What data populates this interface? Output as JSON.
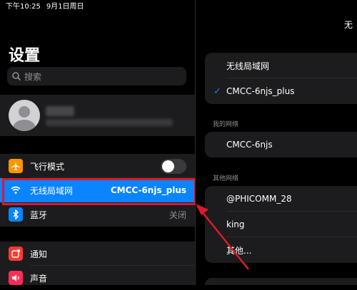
{
  "status_bar": {
    "time": "下午10:25",
    "date": "9月1日周日"
  },
  "sidebar": {
    "title": "设置",
    "search_placeholder": "搜索",
    "rows": [
      {
        "label": "飞行模式",
        "icon": "airplane-icon",
        "toggle": false
      },
      {
        "label": "无线局域网",
        "value": "CMCC-6njs_plus",
        "icon": "wifi-icon",
        "selected": true
      },
      {
        "label": "蓝牙",
        "value": "关闭",
        "icon": "bluetooth-icon"
      },
      {
        "label": "通知",
        "icon": "notification-icon"
      },
      {
        "label": "声音",
        "icon": "sound-icon"
      }
    ]
  },
  "detail": {
    "title": "无",
    "toggle_label": "无线局域网",
    "connected_network": "CMCC-6njs_plus",
    "my_networks_header": "我的网络",
    "my_networks": [
      "CMCC-6njs"
    ],
    "other_networks_header": "其他网络",
    "other_networks": [
      "@PHICOMM_28",
      "king",
      "其他..."
    ]
  },
  "colors": {
    "accent": "#0a84ff",
    "highlight": "#e0192b",
    "background": "#000000",
    "cell": "#1c1c1e"
  }
}
